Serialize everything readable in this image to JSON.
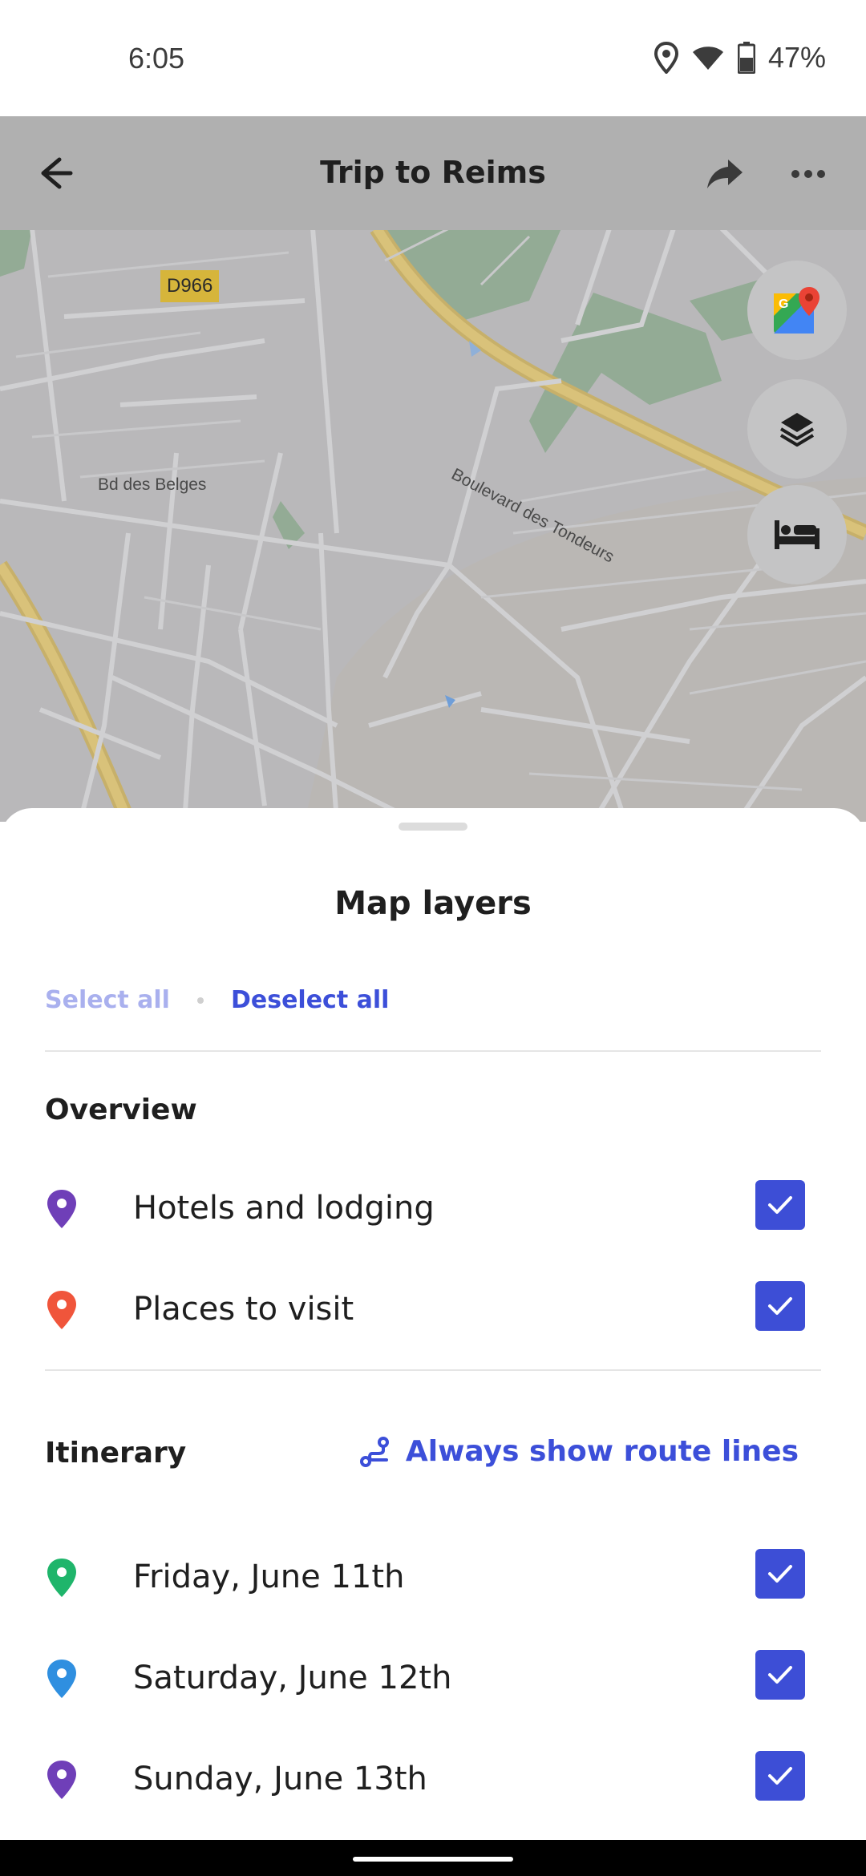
{
  "status_bar": {
    "time": "6:05",
    "battery": "47%",
    "icons": [
      "location-icon",
      "wifi-icon",
      "battery-icon"
    ]
  },
  "header": {
    "title": "Trip to Reims",
    "icons": [
      "back-arrow-icon",
      "share-icon",
      "more-icon"
    ]
  },
  "map": {
    "road_badge": "D966",
    "labels": {
      "boulevard": "Boulevard des Tondeurs",
      "bd_belges": "Bd des Belges"
    },
    "fab_icons": [
      "google-maps-icon",
      "layers-icon",
      "bed-icon"
    ]
  },
  "sheet": {
    "title": "Map layers",
    "select_all": "Select all",
    "deselect_all": "Deselect all",
    "overview": {
      "heading": "Overview",
      "items": [
        {
          "label": "Hotels and lodging",
          "pin_color": "#6f3fb8",
          "checked": true
        },
        {
          "label": "Places to visit",
          "pin_color": "#f0553b",
          "checked": true
        }
      ]
    },
    "itinerary": {
      "heading": "Itinerary",
      "route_link": "Always show route lines",
      "items": [
        {
          "label": "Friday, June 11th",
          "pin_color": "#1fb56b",
          "checked": true
        },
        {
          "label": "Saturday, June 12th",
          "pin_color": "#2f8fe0",
          "checked": true
        },
        {
          "label": "Sunday, June 13th",
          "pin_color": "#6f3fb8",
          "checked": true
        }
      ]
    }
  },
  "colors": {
    "accent": "#3c4fd9",
    "checkbox": "#3d4ed6",
    "select_all_disabled": "#a9b0ee"
  }
}
